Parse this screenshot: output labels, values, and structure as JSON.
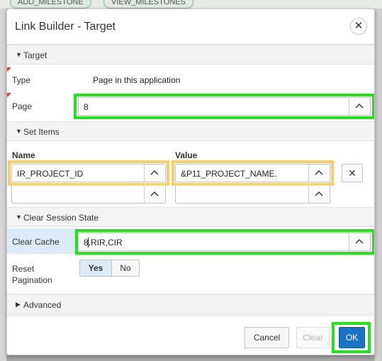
{
  "background": {
    "chips": [
      "ADD_MILESTONE",
      "VIEW_MILESTONES"
    ]
  },
  "dialog": {
    "title": "Link Builder - Target",
    "close_icon": "close-icon"
  },
  "target_region": {
    "header": "Target",
    "type_label": "Type",
    "type_value": "Page in this application",
    "page_label": "Page",
    "page_value": "8"
  },
  "set_items_region": {
    "header": "Set Items",
    "col_name": "Name",
    "col_value": "Value",
    "rows": [
      {
        "name": "IR_PROJECT_ID",
        "value": "&P11_PROJECT_NAME."
      },
      {
        "name": "",
        "value": ""
      }
    ]
  },
  "clear_session_region": {
    "header": "Clear Session State",
    "clear_cache_label": "Clear Cache",
    "clear_cache_value": "8,RIR,CIR",
    "reset_pagination_label_line1": "Reset",
    "reset_pagination_label_line2": "Pagination",
    "reset_yes": "Yes",
    "reset_no": "No",
    "reset_selected": "Yes"
  },
  "advanced_region": {
    "header": "Advanced"
  },
  "footer": {
    "cancel": "Cancel",
    "clear": "Clear",
    "ok": "OK"
  },
  "colors": {
    "highlight_green": "#22e31b",
    "highlight_yellow": "#f7cd6d",
    "primary_button": "#1b74c3",
    "selected_toggle": "#dcebf8"
  }
}
